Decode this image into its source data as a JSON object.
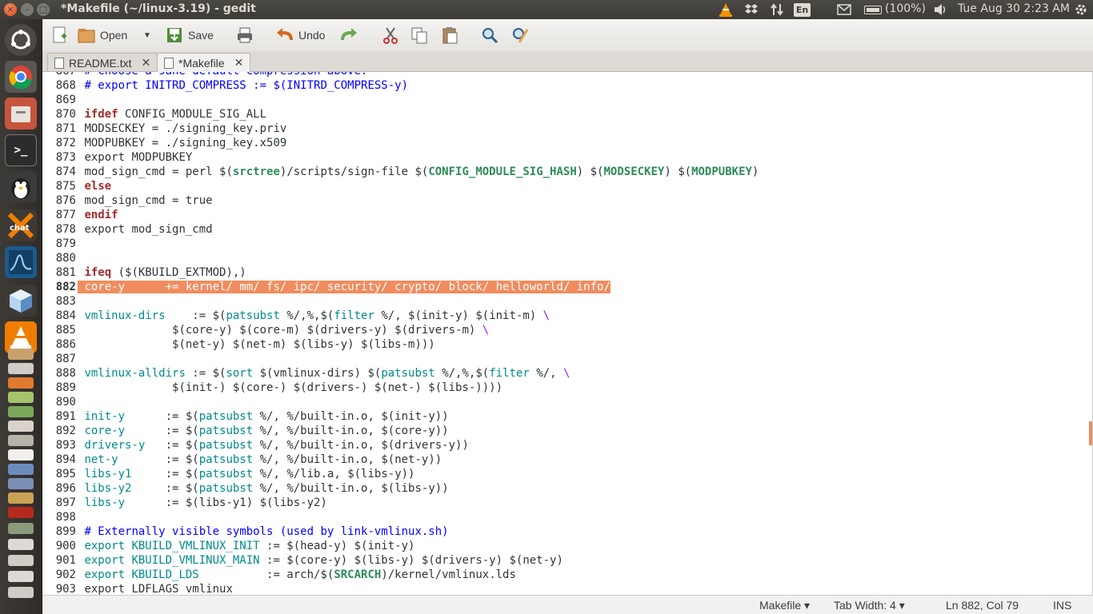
{
  "window": {
    "title": "*Makefile (~/linux-3.19) - gedit",
    "close_glyph": "×",
    "min_glyph": "–",
    "max_glyph": "□"
  },
  "panel": {
    "language": "En",
    "battery": "(100%)",
    "clock": "Tue Aug 30  2:23 AM"
  },
  "toolbar": {
    "open_label": "Open",
    "save_label": "Save",
    "undo_label": "Undo"
  },
  "tabs": [
    {
      "label": "README.txt",
      "active": false
    },
    {
      "label": "*Makefile",
      "active": true
    }
  ],
  "editor": {
    "current_line": "882",
    "lines": [
      {
        "n": "867",
        "segments": [
          {
            "t": "# Choose a sane default compression above.",
            "c": "cm"
          }
        ]
      },
      {
        "n": "868",
        "segments": [
          {
            "t": "# export INITRD_COMPRESS := $(INITRD_COMPRESS-y)",
            "c": "cm"
          }
        ]
      },
      {
        "n": "869",
        "segments": []
      },
      {
        "n": "870",
        "segments": [
          {
            "t": "ifdef",
            "c": "kw"
          },
          {
            "t": " CONFIG_MODULE_SIG_ALL",
            "c": ""
          }
        ]
      },
      {
        "n": "871",
        "segments": [
          {
            "t": "MODSECKEY = ./signing_key.priv",
            "c": ""
          }
        ]
      },
      {
        "n": "872",
        "segments": [
          {
            "t": "MODPUBKEY = ./signing_key.x509",
            "c": ""
          }
        ]
      },
      {
        "n": "873",
        "segments": [
          {
            "t": "export MODPUBKEY",
            "c": ""
          }
        ]
      },
      {
        "n": "874",
        "segments": [
          {
            "t": "mod_sign_cmd = perl $(",
            "c": ""
          },
          {
            "t": "srctree",
            "c": "var"
          },
          {
            "t": ")/scripts/sign-file $(",
            "c": ""
          },
          {
            "t": "CONFIG_MODULE_SIG_HASH",
            "c": "var"
          },
          {
            "t": ") $(",
            "c": ""
          },
          {
            "t": "MODSECKEY",
            "c": "var"
          },
          {
            "t": ") $(",
            "c": ""
          },
          {
            "t": "MODPUBKEY",
            "c": "var"
          },
          {
            "t": ")",
            "c": ""
          }
        ]
      },
      {
        "n": "875",
        "segments": [
          {
            "t": "else",
            "c": "kw"
          }
        ]
      },
      {
        "n": "876",
        "segments": [
          {
            "t": "mod_sign_cmd = true",
            "c": ""
          }
        ]
      },
      {
        "n": "877",
        "segments": [
          {
            "t": "endif",
            "c": "kw"
          }
        ]
      },
      {
        "n": "878",
        "segments": [
          {
            "t": "export mod_sign_cmd",
            "c": ""
          }
        ]
      },
      {
        "n": "879",
        "segments": []
      },
      {
        "n": "880",
        "segments": []
      },
      {
        "n": "881",
        "segments": [
          {
            "t": "ifeq",
            "c": "kw"
          },
          {
            "t": " ($(KBUILD_EXTMOD),)",
            "c": ""
          }
        ]
      },
      {
        "n": "882",
        "highlight": true,
        "segments": [
          {
            "t": "core-y      += kernel/ mm/ fs/ ipc/ security/ crypto/ block/ helloworld/ info/",
            "c": ""
          }
        ]
      },
      {
        "n": "883",
        "segments": []
      },
      {
        "n": "884",
        "segments": [
          {
            "t": "vmlinux-dirs",
            "c": "fn"
          },
          {
            "t": "    := $(",
            "c": ""
          },
          {
            "t": "patsubst",
            "c": "fn"
          },
          {
            "t": " %/,%,$(",
            "c": ""
          },
          {
            "t": "filter",
            "c": "fn"
          },
          {
            "t": " %/, $(init-y) $(init-m) ",
            "c": ""
          },
          {
            "t": "\\",
            "c": "bs"
          }
        ]
      },
      {
        "n": "885",
        "segments": [
          {
            "t": "             $(core-y) $(core-m) $(drivers-y) $(drivers-m) ",
            "c": ""
          },
          {
            "t": "\\",
            "c": "bs"
          }
        ]
      },
      {
        "n": "886",
        "segments": [
          {
            "t": "             $(net-y) $(net-m) $(libs-y) $(libs-m)))",
            "c": ""
          }
        ]
      },
      {
        "n": "887",
        "segments": []
      },
      {
        "n": "888",
        "segments": [
          {
            "t": "vmlinux-alldirs",
            "c": "fn"
          },
          {
            "t": " := $(",
            "c": ""
          },
          {
            "t": "sort",
            "c": "fn"
          },
          {
            "t": " $(vmlinux-dirs) $(",
            "c": ""
          },
          {
            "t": "patsubst",
            "c": "fn"
          },
          {
            "t": " %/,%,$(",
            "c": ""
          },
          {
            "t": "filter",
            "c": "fn"
          },
          {
            "t": " %/, ",
            "c": ""
          },
          {
            "t": "\\",
            "c": "bs"
          }
        ]
      },
      {
        "n": "889",
        "segments": [
          {
            "t": "             $(init-) $(core-) $(drivers-) $(net-) $(libs-))))",
            "c": ""
          }
        ]
      },
      {
        "n": "890",
        "segments": []
      },
      {
        "n": "891",
        "segments": [
          {
            "t": "init-y",
            "c": "fn"
          },
          {
            "t": "      := $(",
            "c": ""
          },
          {
            "t": "patsubst",
            "c": "fn"
          },
          {
            "t": " %/, %/built-in.o, $(init-y))",
            "c": ""
          }
        ]
      },
      {
        "n": "892",
        "segments": [
          {
            "t": "core-y",
            "c": "fn"
          },
          {
            "t": "      := $(",
            "c": ""
          },
          {
            "t": "patsubst",
            "c": "fn"
          },
          {
            "t": " %/, %/built-in.o, $(core-y))",
            "c": ""
          }
        ]
      },
      {
        "n": "893",
        "segments": [
          {
            "t": "drivers-y",
            "c": "fn"
          },
          {
            "t": "   := $(",
            "c": ""
          },
          {
            "t": "patsubst",
            "c": "fn"
          },
          {
            "t": " %/, %/built-in.o, $(drivers-y))",
            "c": ""
          }
        ]
      },
      {
        "n": "894",
        "segments": [
          {
            "t": "net-y",
            "c": "fn"
          },
          {
            "t": "       := $(",
            "c": ""
          },
          {
            "t": "patsubst",
            "c": "fn"
          },
          {
            "t": " %/, %/built-in.o, $(net-y))",
            "c": ""
          }
        ]
      },
      {
        "n": "895",
        "segments": [
          {
            "t": "libs-y1",
            "c": "fn"
          },
          {
            "t": "     := $(",
            "c": ""
          },
          {
            "t": "patsubst",
            "c": "fn"
          },
          {
            "t": " %/, %/lib.a, $(libs-y))",
            "c": ""
          }
        ]
      },
      {
        "n": "896",
        "segments": [
          {
            "t": "libs-y2",
            "c": "fn"
          },
          {
            "t": "     := $(",
            "c": ""
          },
          {
            "t": "patsubst",
            "c": "fn"
          },
          {
            "t": " %/, %/built-in.o, $(libs-y))",
            "c": ""
          }
        ]
      },
      {
        "n": "897",
        "segments": [
          {
            "t": "libs-y",
            "c": "fn"
          },
          {
            "t": "      := $(libs-y1) $(libs-y2)",
            "c": ""
          }
        ]
      },
      {
        "n": "898",
        "segments": []
      },
      {
        "n": "899",
        "segments": [
          {
            "t": "# Externally visible symbols (used by link-vmlinux.sh)",
            "c": "cm"
          }
        ]
      },
      {
        "n": "900",
        "segments": [
          {
            "t": "export KBUILD_VMLINUX_INIT",
            "c": "fn"
          },
          {
            "t": " := $(head-y) $(init-y)",
            "c": ""
          }
        ]
      },
      {
        "n": "901",
        "segments": [
          {
            "t": "export KBUILD_VMLINUX_MAIN",
            "c": "fn"
          },
          {
            "t": " := $(core-y) $(libs-y) $(drivers-y) $(net-y)",
            "c": ""
          }
        ]
      },
      {
        "n": "902",
        "segments": [
          {
            "t": "export KBUILD_LDS",
            "c": "fn"
          },
          {
            "t": "          := arch/$(",
            "c": ""
          },
          {
            "t": "SRCARCH",
            "c": "var"
          },
          {
            "t": ")/kernel/vmlinux.lds",
            "c": ""
          }
        ]
      },
      {
        "n": "903",
        "segments": [
          {
            "t": "export LDFLAGS_vmlinux",
            "c": ""
          }
        ]
      }
    ]
  },
  "statusbar": {
    "language": "Makefile ▾",
    "tab_width": "Tab Width: 4 ▾",
    "position": "Ln 882, Col 79",
    "mode": "INS"
  },
  "colors": {
    "highlight": "#f08c5e",
    "keyword": "#a52a2a",
    "function": "#008a8c",
    "comment": "#0000ff",
    "variable": "#2e8b57"
  }
}
